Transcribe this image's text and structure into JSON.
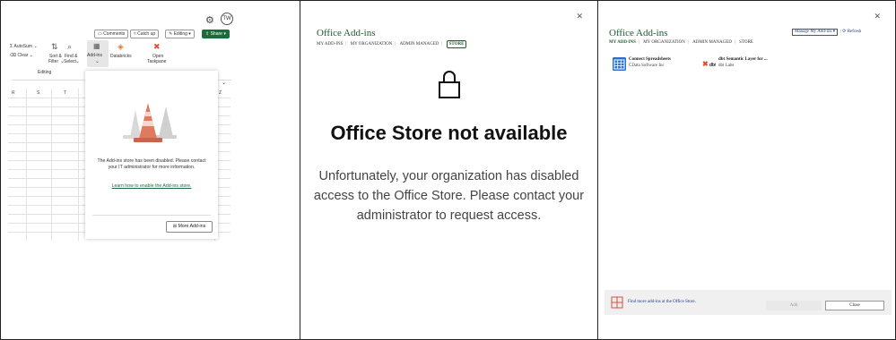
{
  "excel": {
    "avatar": "TW",
    "actions": {
      "comments": "Comments",
      "catch_up": "Catch up",
      "editing": "Editing",
      "share": "Share"
    },
    "ribbon": {
      "autosum": "AutoSum",
      "clear": "Clear",
      "sort_filter_1": "Sort &",
      "sort_filter_2": "Filter",
      "find_select_1": "Find &",
      "find_select_2": "Select",
      "group_label": "Editing",
      "addins": "Add-ins",
      "databricks": "Databricks",
      "open_taskpane_1": "Open",
      "open_taskpane_2": "Taskpane"
    },
    "columns": [
      "R",
      "S",
      "T",
      "Z"
    ],
    "pane": {
      "message": "The Add-ins store has been disabled. Please contact your IT administrator for more information.",
      "link": "Learn how to enable the Add-ins store.",
      "more_button": "More Add-ins"
    }
  },
  "store_dialog": {
    "title": "Office Add-ins",
    "tabs": [
      "MY ADD-INS",
      "MY ORGANIZATION",
      "ADMIN MANAGED",
      "STORE"
    ],
    "heading": "Office Store not available",
    "message": "Unfortunately, your organization has disabled access to the Office Store. Please contact your administrator to request access."
  },
  "my_addins_dialog": {
    "title": "Office Add-ins",
    "tabs": [
      "MY ADD-INS",
      "MY ORGANIZATION",
      "ADMIN MANAGED",
      "STORE"
    ],
    "manage": "Manage My Add-ins",
    "refresh": "Refresh",
    "addins": [
      {
        "name": "Connect Spreadsheets",
        "publisher": "CData Software Inc",
        "icon": "spreadsheet-icon"
      },
      {
        "name": "dbt Semantic Layer for ...",
        "publisher": "dbt Labs",
        "icon": "dbt-logo-icon"
      }
    ],
    "footer_link": "Find more add-ins at the Office Store.",
    "add_button": "Add",
    "close_button": "Close"
  },
  "colors": {
    "excel_green": "#1d6b3b",
    "dialog_green": "#1d5b2f",
    "link_blue": "#1a3f8a",
    "cone_orange": "#e07a5f"
  }
}
